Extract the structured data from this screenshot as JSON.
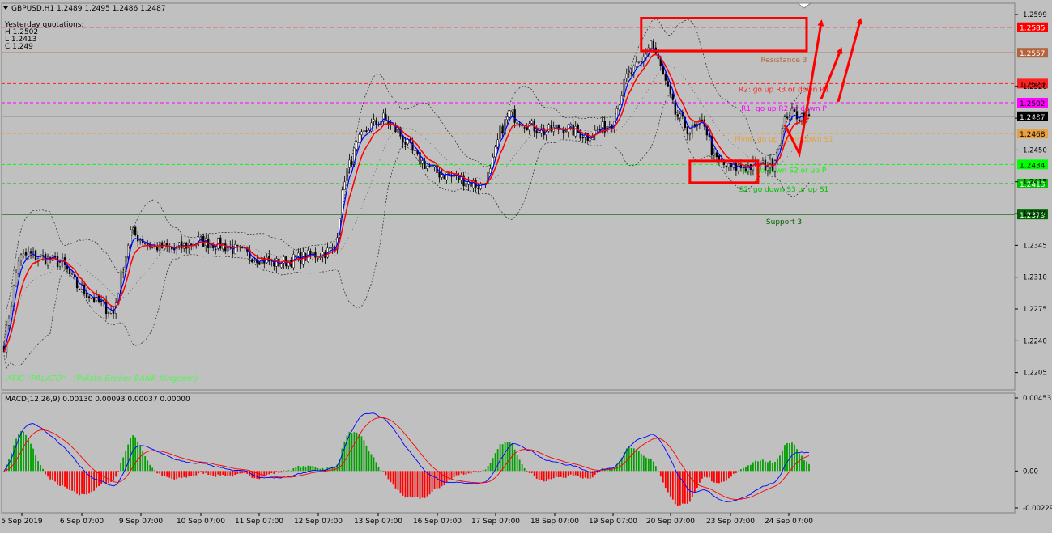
{
  "chart_data": [
    {
      "type": "candlestick",
      "title": "GBPUSD,H1  1.2489 1.2495 1.2486 1.2487",
      "symbol": "GBPUSD",
      "timeframe": "H1",
      "last_ohlc": {
        "open": 1.2489,
        "high": 1.2495,
        "low": 1.2486,
        "close": 1.2487
      },
      "yesterday_quotations": {
        "title": "Yesterday quotations:",
        "H": "H 1.2502",
        "L": "L 1.2413",
        "C": "C 1.249"
      },
      "ylim": [
        1.2186,
        1.2599
      ],
      "yticks": [
        "1.2599",
        "1.2520",
        "1.2485",
        "1.2450",
        "1.2415",
        "1.2380",
        "1.2345",
        "1.2310",
        "1.2275",
        "1.2240",
        "1.2205"
      ],
      "x_labels": [
        "5 Sep 2019",
        "6 Sep 07:00",
        "9 Sep 07:00",
        "10 Sep 07:00",
        "11 Sep 07:00",
        "12 Sep 07:00",
        "13 Sep 07:00",
        "16 Sep 07:00",
        "17 Sep 07:00",
        "18 Sep 07:00",
        "19 Sep 07:00",
        "20 Sep 07:00",
        "23 Sep 07:00",
        "24 Sep 07:00"
      ],
      "levels": [
        {
          "name": "Resistance 3",
          "price": 1.2557,
          "color": "#b4643c",
          "label": "Resistance 3",
          "tag": "1.2557"
        },
        {
          "name": "R2",
          "price": 1.2523,
          "color": "#ff2020",
          "label": "R2: go up R3 or down R1",
          "tag": "1.2523"
        },
        {
          "name": "R1",
          "price": 1.2502,
          "color": "#ff00ff",
          "label": "R1: go up R2 or down P",
          "tag": "1.2502"
        },
        {
          "name": "Pivot",
          "price": 1.2468,
          "color": "#e8a040",
          "label": "Pivot: go up R1 or down S1",
          "tag": "1.2468"
        },
        {
          "name": "S1",
          "price": 1.2434,
          "color": "#00ff00",
          "label": "S1: go down S2 or up P",
          "tag": "1.2434"
        },
        {
          "name": "S2",
          "price": 1.2413,
          "color": "#00c000",
          "label": "S2: go down S3 or up S1",
          "tag": "1.2413"
        },
        {
          "name": "Support 3",
          "price": 1.2379,
          "color": "#006400",
          "label": "Support 3",
          "tag": "1.2379"
        }
      ],
      "price_tags": [
        {
          "price": 1.2585,
          "text": "1.2585",
          "color": "#ff0000"
        },
        {
          "price": 1.2487,
          "text": "1.2487",
          "color": "#000000"
        }
      ],
      "close_anchors": [
        [
          0,
          1.2235
        ],
        [
          6,
          1.233
        ],
        [
          10,
          1.2335
        ],
        [
          18,
          1.233
        ],
        [
          24,
          1.2325
        ],
        [
          30,
          1.23
        ],
        [
          40,
          1.228
        ],
        [
          45,
          1.227
        ],
        [
          52,
          1.236
        ],
        [
          60,
          1.2345
        ],
        [
          70,
          1.234
        ],
        [
          80,
          1.235
        ],
        [
          90,
          1.2345
        ],
        [
          100,
          1.2335
        ],
        [
          112,
          1.2325
        ],
        [
          128,
          1.2335
        ],
        [
          136,
          1.234
        ],
        [
          140,
          1.242
        ],
        [
          146,
          1.246
        ],
        [
          150,
          1.2475
        ],
        [
          156,
          1.2485
        ],
        [
          162,
          1.247
        ],
        [
          170,
          1.244
        ],
        [
          178,
          1.2425
        ],
        [
          186,
          1.242
        ],
        [
          196,
          1.241
        ],
        [
          200,
          1.2425
        ],
        [
          204,
          1.247
        ],
        [
          208,
          1.249
        ],
        [
          214,
          1.248
        ],
        [
          222,
          1.247
        ],
        [
          230,
          1.2475
        ],
        [
          240,
          1.2465
        ],
        [
          250,
          1.248
        ],
        [
          256,
          1.253
        ],
        [
          262,
          1.2545
        ],
        [
          266,
          1.257
        ],
        [
          270,
          1.254
        ],
        [
          276,
          1.249
        ],
        [
          282,
          1.247
        ],
        [
          288,
          1.248
        ],
        [
          292,
          1.244
        ],
        [
          298,
          1.243
        ],
        [
          306,
          1.2432
        ],
        [
          316,
          1.2434
        ],
        [
          322,
          1.249
        ],
        [
          331,
          1.2487
        ]
      ],
      "bar_count": 332,
      "indicators": [
        {
          "name": "EMA fast",
          "color": "#0000ff"
        },
        {
          "name": "EMA slow",
          "color": "#ff0000"
        },
        {
          "name": "Bollinger Bands",
          "color": "#000000"
        }
      ],
      "annotations": {
        "boxes": [
          {
            "type": "rectangle",
            "from_bar": 262,
            "to_bar": 330,
            "price_top": 1.2595,
            "price_bottom": 1.2559,
            "color": "#ff0000"
          },
          {
            "type": "rectangle",
            "from_bar": 282,
            "to_bar": 310,
            "price_top": 1.2438,
            "price_bottom": 1.2414,
            "color": "#ff0000"
          }
        ],
        "arrows": [
          {
            "color": "#ff0000",
            "points": [
              [
                321,
                1.2478
              ],
              [
                327,
                1.2446
              ],
              [
                336,
                1.259
              ]
            ]
          },
          {
            "color": "#ff0000",
            "points": [
              [
                336,
                1.2506
              ],
              [
                344,
                1.256
              ]
            ]
          },
          {
            "color": "#ff0000",
            "points": [
              [
                343,
                1.2503
              ],
              [
                352,
                1.2592
              ]
            ]
          }
        ]
      },
      "footer_text": "AFIC \"PALATO\" - (Palato Broker BANK Kingdom)"
    },
    {
      "type": "bar",
      "title": "MACD(12,26,9) 0.00130 0.00093 0.00037 0.00000",
      "indicator": "MACD",
      "params": [
        12,
        26,
        9
      ],
      "values_text": "0.00130 0.00093 0.00037 0.00000",
      "yticks": [
        "0.00453",
        "0.00",
        "-0.00229"
      ],
      "ylim": [
        -0.00229,
        0.00453
      ],
      "series": [
        {
          "name": "MACD",
          "color": "#0000ff"
        },
        {
          "name": "Signal",
          "color": "#ff0000"
        },
        {
          "name": "Histogram",
          "positive_color": "#00a000",
          "negative_color": "#ff0000"
        }
      ]
    }
  ]
}
